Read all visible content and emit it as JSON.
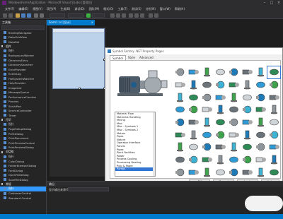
{
  "window": {
    "title": "WindowsFormsApplication - Microsoft Visual Studio (管理员)"
  },
  "menu": [
    "文件(F)",
    "编辑(E)",
    "视图(V)",
    "项目(P)",
    "生成(B)",
    "调试(D)",
    "团队(M)",
    "格式(O)",
    "工具(T)",
    "测试(S)",
    "分析(N)",
    "窗口(W)",
    "帮助(H)"
  ],
  "toolbox": {
    "title": "工具箱",
    "items": [
      {
        "label": "BindingNavigator",
        "kind": "item"
      },
      {
        "label": "DataGridView",
        "kind": "item"
      },
      {
        "label": "DataSet",
        "kind": "item"
      },
      {
        "label": "组件",
        "kind": "group"
      },
      {
        "label": "指针",
        "kind": "item"
      },
      {
        "label": "BackgroundWorker",
        "kind": "item"
      },
      {
        "label": "DirectoryEntry",
        "kind": "item"
      },
      {
        "label": "DirectorySearcher",
        "kind": "item"
      },
      {
        "label": "ErrorProvider",
        "kind": "item"
      },
      {
        "label": "EventLog",
        "kind": "item"
      },
      {
        "label": "FileSystemWatcher",
        "kind": "item"
      },
      {
        "label": "HelpProvider",
        "kind": "item"
      },
      {
        "label": "ImageList",
        "kind": "item"
      },
      {
        "label": "MessageQueue",
        "kind": "item"
      },
      {
        "label": "PerformanceCounter",
        "kind": "item"
      },
      {
        "label": "Process",
        "kind": "item"
      },
      {
        "label": "SerialPort",
        "kind": "item"
      },
      {
        "label": "ServiceController",
        "kind": "item"
      },
      {
        "label": "Timer",
        "kind": "item"
      },
      {
        "label": "打印",
        "kind": "group"
      },
      {
        "label": "指针",
        "kind": "item"
      },
      {
        "label": "PageSetupDialog",
        "kind": "item"
      },
      {
        "label": "PrintDialog",
        "kind": "item"
      },
      {
        "label": "PrintDocument",
        "kind": "item"
      },
      {
        "label": "PrintPreviewControl",
        "kind": "item"
      },
      {
        "label": "PrintPreviewDialog",
        "kind": "item"
      },
      {
        "label": "对话框",
        "kind": "group"
      },
      {
        "label": "指针",
        "kind": "item"
      },
      {
        "label": "ColorDialog",
        "kind": "item"
      },
      {
        "label": "FolderBrowserDialog",
        "kind": "item"
      },
      {
        "label": "FontDialog",
        "kind": "item"
      },
      {
        "label": "OpenFileDialog",
        "kind": "item"
      },
      {
        "label": "SaveFileDialog",
        "kind": "item"
      },
      {
        "label": "常规",
        "kind": "group"
      },
      {
        "label": "指针",
        "kind": "item",
        "selected": true
      },
      {
        "label": "CustomerControl",
        "kind": "item"
      },
      {
        "label": "Standard Control",
        "kind": "item"
      }
    ]
  },
  "editor": {
    "tab_label": "Form1.cs [设计]"
  },
  "dialog": {
    "title": "Symbol Factory .NET Property Pages",
    "tabs": [
      "Symbol",
      "Style",
      "Advanced"
    ],
    "library": [
      "Material Flow",
      "Materials Handling",
      "Mining",
      "Misc",
      "Misc - Symbols 1",
      "Misc - Symbols 2",
      "Motors",
      "Pipes",
      "Nature",
      "Operator Interface",
      "Panels",
      "Pipes",
      "Plant Facilities",
      "Power",
      "Process Cooling",
      "Processing Heating",
      "Pulp & Paper",
      "Pumps"
    ],
    "selected_library": "Pumps",
    "buttons": {
      "ok": "OK",
      "cancel": "Cancel",
      "apply": "Apply",
      "help": "Help"
    }
  },
  "output": {
    "title": "输出",
    "source_label": "显示输出来源(S):"
  },
  "colors": {
    "vs_dark": "#1e1e1e",
    "accent": "#007acc",
    "selection": "#3377d6"
  }
}
